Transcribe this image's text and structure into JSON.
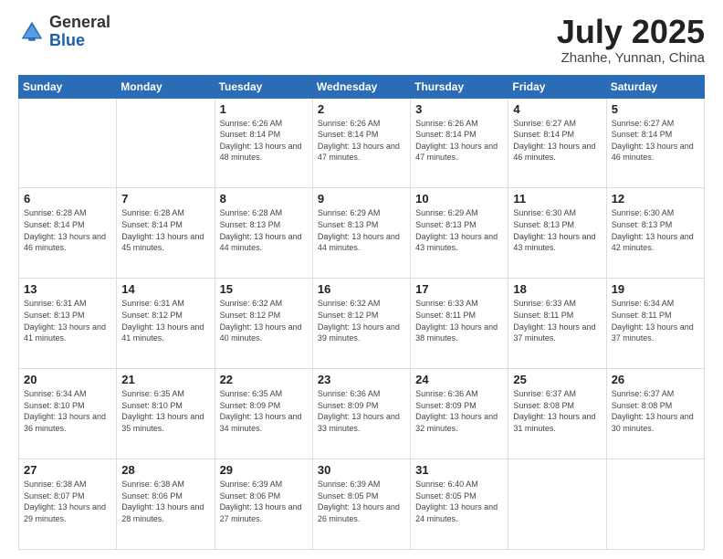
{
  "logo": {
    "general": "General",
    "blue": "Blue"
  },
  "header": {
    "title": "July 2025",
    "subtitle": "Zhanhe, Yunnan, China"
  },
  "weekdays": [
    "Sunday",
    "Monday",
    "Tuesday",
    "Wednesday",
    "Thursday",
    "Friday",
    "Saturday"
  ],
  "weeks": [
    [
      {
        "day": "",
        "info": ""
      },
      {
        "day": "",
        "info": ""
      },
      {
        "day": "1",
        "info": "Sunrise: 6:26 AM\nSunset: 8:14 PM\nDaylight: 13 hours and 48 minutes."
      },
      {
        "day": "2",
        "info": "Sunrise: 6:26 AM\nSunset: 8:14 PM\nDaylight: 13 hours and 47 minutes."
      },
      {
        "day": "3",
        "info": "Sunrise: 6:26 AM\nSunset: 8:14 PM\nDaylight: 13 hours and 47 minutes."
      },
      {
        "day": "4",
        "info": "Sunrise: 6:27 AM\nSunset: 8:14 PM\nDaylight: 13 hours and 46 minutes."
      },
      {
        "day": "5",
        "info": "Sunrise: 6:27 AM\nSunset: 8:14 PM\nDaylight: 13 hours and 46 minutes."
      }
    ],
    [
      {
        "day": "6",
        "info": "Sunrise: 6:28 AM\nSunset: 8:14 PM\nDaylight: 13 hours and 46 minutes."
      },
      {
        "day": "7",
        "info": "Sunrise: 6:28 AM\nSunset: 8:14 PM\nDaylight: 13 hours and 45 minutes."
      },
      {
        "day": "8",
        "info": "Sunrise: 6:28 AM\nSunset: 8:13 PM\nDaylight: 13 hours and 44 minutes."
      },
      {
        "day": "9",
        "info": "Sunrise: 6:29 AM\nSunset: 8:13 PM\nDaylight: 13 hours and 44 minutes."
      },
      {
        "day": "10",
        "info": "Sunrise: 6:29 AM\nSunset: 8:13 PM\nDaylight: 13 hours and 43 minutes."
      },
      {
        "day": "11",
        "info": "Sunrise: 6:30 AM\nSunset: 8:13 PM\nDaylight: 13 hours and 43 minutes."
      },
      {
        "day": "12",
        "info": "Sunrise: 6:30 AM\nSunset: 8:13 PM\nDaylight: 13 hours and 42 minutes."
      }
    ],
    [
      {
        "day": "13",
        "info": "Sunrise: 6:31 AM\nSunset: 8:13 PM\nDaylight: 13 hours and 41 minutes."
      },
      {
        "day": "14",
        "info": "Sunrise: 6:31 AM\nSunset: 8:12 PM\nDaylight: 13 hours and 41 minutes."
      },
      {
        "day": "15",
        "info": "Sunrise: 6:32 AM\nSunset: 8:12 PM\nDaylight: 13 hours and 40 minutes."
      },
      {
        "day": "16",
        "info": "Sunrise: 6:32 AM\nSunset: 8:12 PM\nDaylight: 13 hours and 39 minutes."
      },
      {
        "day": "17",
        "info": "Sunrise: 6:33 AM\nSunset: 8:11 PM\nDaylight: 13 hours and 38 minutes."
      },
      {
        "day": "18",
        "info": "Sunrise: 6:33 AM\nSunset: 8:11 PM\nDaylight: 13 hours and 37 minutes."
      },
      {
        "day": "19",
        "info": "Sunrise: 6:34 AM\nSunset: 8:11 PM\nDaylight: 13 hours and 37 minutes."
      }
    ],
    [
      {
        "day": "20",
        "info": "Sunrise: 6:34 AM\nSunset: 8:10 PM\nDaylight: 13 hours and 36 minutes."
      },
      {
        "day": "21",
        "info": "Sunrise: 6:35 AM\nSunset: 8:10 PM\nDaylight: 13 hours and 35 minutes."
      },
      {
        "day": "22",
        "info": "Sunrise: 6:35 AM\nSunset: 8:09 PM\nDaylight: 13 hours and 34 minutes."
      },
      {
        "day": "23",
        "info": "Sunrise: 6:36 AM\nSunset: 8:09 PM\nDaylight: 13 hours and 33 minutes."
      },
      {
        "day": "24",
        "info": "Sunrise: 6:36 AM\nSunset: 8:09 PM\nDaylight: 13 hours and 32 minutes."
      },
      {
        "day": "25",
        "info": "Sunrise: 6:37 AM\nSunset: 8:08 PM\nDaylight: 13 hours and 31 minutes."
      },
      {
        "day": "26",
        "info": "Sunrise: 6:37 AM\nSunset: 8:08 PM\nDaylight: 13 hours and 30 minutes."
      }
    ],
    [
      {
        "day": "27",
        "info": "Sunrise: 6:38 AM\nSunset: 8:07 PM\nDaylight: 13 hours and 29 minutes."
      },
      {
        "day": "28",
        "info": "Sunrise: 6:38 AM\nSunset: 8:06 PM\nDaylight: 13 hours and 28 minutes."
      },
      {
        "day": "29",
        "info": "Sunrise: 6:39 AM\nSunset: 8:06 PM\nDaylight: 13 hours and 27 minutes."
      },
      {
        "day": "30",
        "info": "Sunrise: 6:39 AM\nSunset: 8:05 PM\nDaylight: 13 hours and 26 minutes."
      },
      {
        "day": "31",
        "info": "Sunrise: 6:40 AM\nSunset: 8:05 PM\nDaylight: 13 hours and 24 minutes."
      },
      {
        "day": "",
        "info": ""
      },
      {
        "day": "",
        "info": ""
      }
    ]
  ]
}
